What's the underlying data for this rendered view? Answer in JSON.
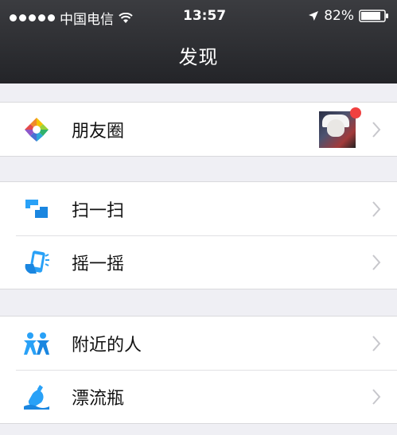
{
  "status_bar": {
    "carrier": "中国电信",
    "time": "13:57",
    "battery": "82%"
  },
  "nav": {
    "title": "发现"
  },
  "groups": [
    {
      "items": [
        {
          "label": "朋友圈",
          "icon": "moments-icon",
          "has_avatar": true,
          "has_badge": true
        }
      ]
    },
    {
      "items": [
        {
          "label": "扫一扫",
          "icon": "scan-icon"
        },
        {
          "label": "摇一摇",
          "icon": "shake-icon"
        }
      ]
    },
    {
      "items": [
        {
          "label": "附近的人",
          "icon": "people-nearby-icon"
        },
        {
          "label": "漂流瓶",
          "icon": "drift-bottle-icon"
        }
      ]
    }
  ],
  "colors": {
    "nav_bg": "#2f3034",
    "page_bg": "#efeff4",
    "badge": "#f04040",
    "accent_blue": "#29a1f7"
  }
}
